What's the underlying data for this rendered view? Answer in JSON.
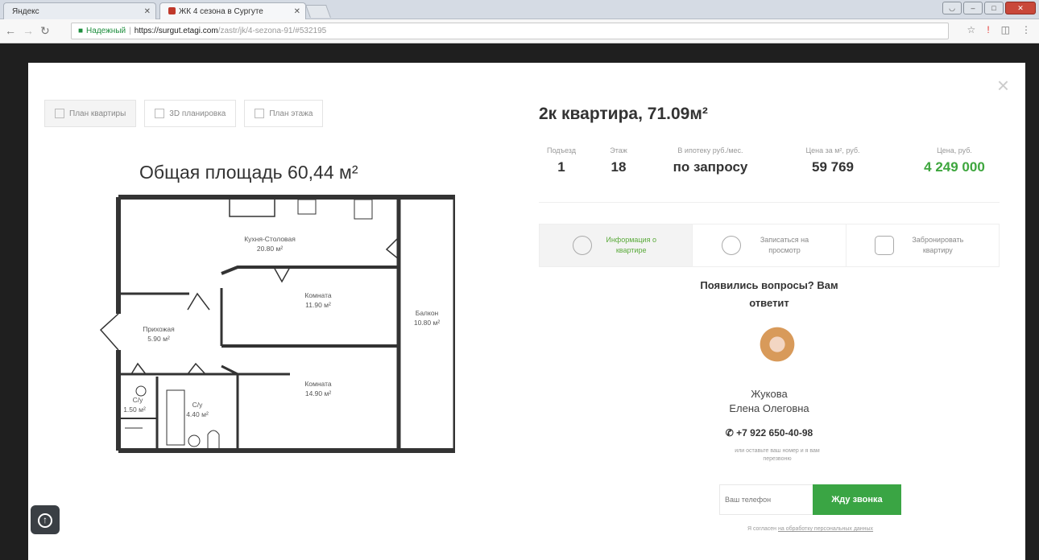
{
  "browser": {
    "tabs": [
      {
        "title": "Яндекс"
      },
      {
        "title": "ЖК 4 сезона в Сургуте"
      }
    ],
    "secure_label": "Надежный",
    "url_host": "https://surgut.etagi.com",
    "url_path": "/zastr/jk/4-sezona-91/#532195"
  },
  "plan_tabs": [
    {
      "label": "План квартиры"
    },
    {
      "label": "3D планировка"
    },
    {
      "label": "План этажа"
    }
  ],
  "area_title": "Общая площадь 60,44 м²",
  "rooms": [
    {
      "name": "Кухня-Столовая",
      "area": "20.80 м²"
    },
    {
      "name": "Комната",
      "area": "11.90 м²"
    },
    {
      "name": "Балкон",
      "area": "10.80 м²"
    },
    {
      "name": "Прихожая",
      "area": "5.90 м²"
    },
    {
      "name": "Комната",
      "area": "14.90 м²"
    },
    {
      "name": "С/у",
      "area": "1.50 м²"
    },
    {
      "name": "С/у",
      "area": "4.40 м²"
    }
  ],
  "apartment": {
    "title": "2к квартира, 71.09м²",
    "stats": [
      {
        "label": "Подъезд",
        "value": "1"
      },
      {
        "label": "Этаж",
        "value": "18"
      },
      {
        "label": "В ипотеку руб./мес.",
        "value": "по запросу"
      },
      {
        "label": "Цена за м², руб.",
        "value": "59 769"
      },
      {
        "label": "Цена, руб.",
        "value": "4 249 000"
      }
    ],
    "price_color": "#3ea63e"
  },
  "action_tabs": [
    {
      "label": "Информация о квартире",
      "icon": "person-icon"
    },
    {
      "label": "Записаться на просмотр",
      "icon": "hand-icon"
    },
    {
      "label": "Забронировать квартиру",
      "icon": "lock-icon"
    }
  ],
  "agent_panel": {
    "question": "Появились вопросы? Вам ответит",
    "last_name": "Жукова",
    "first_name": "Елена Олеговна",
    "phone": "+7 922 650-40-98",
    "hint": "или оставьте ваш номер и я вам перезвоню",
    "phone_placeholder": "Ваш телефон",
    "button": "Жду звонка",
    "consent_prefix": "Я согласен ",
    "consent_link": "на обработку персональных данных"
  },
  "accent_color": "#3aa544"
}
